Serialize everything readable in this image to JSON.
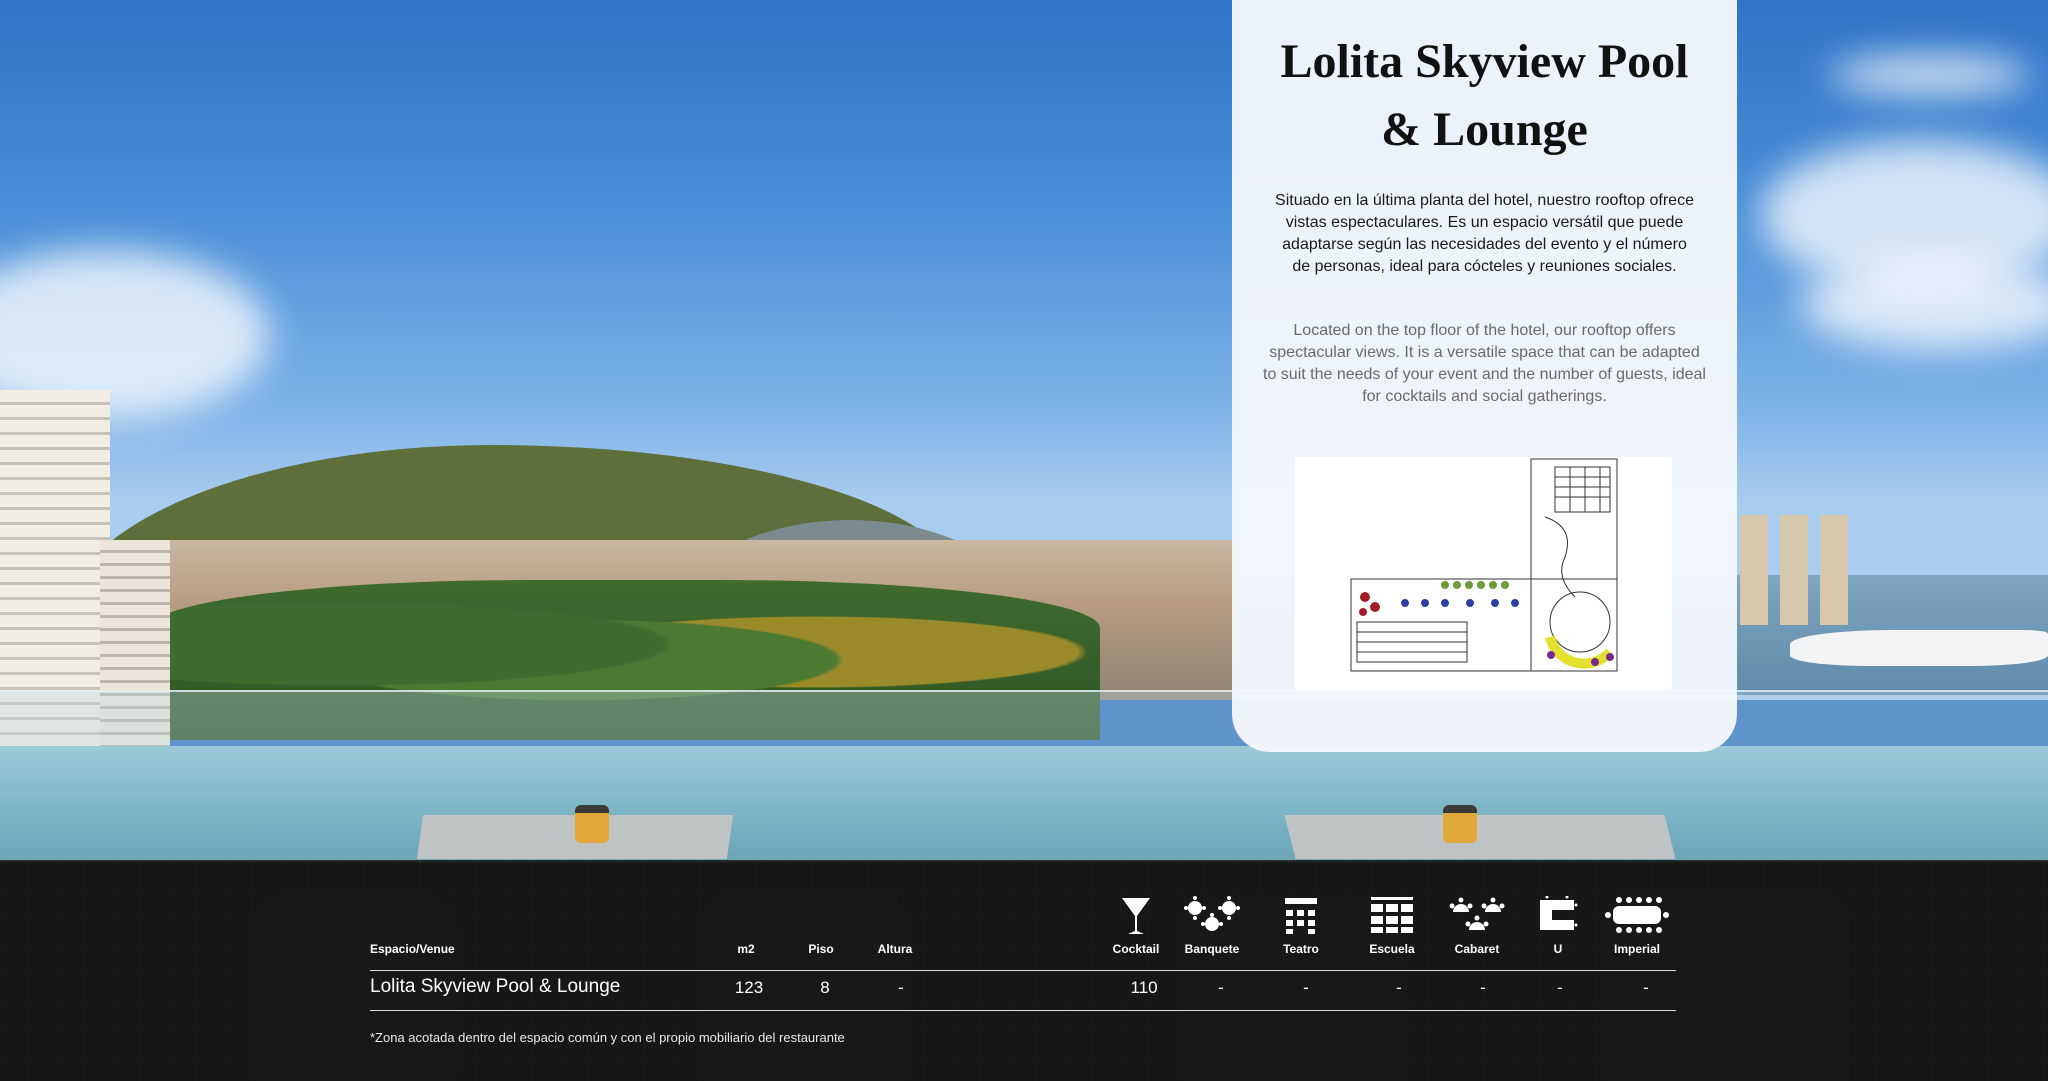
{
  "card": {
    "title": "Lolita Skyview Pool & Lounge",
    "description_es": "Situado en la última planta del hotel, nuestro rooftop ofrece vistas espectaculares. Es un espacio versátil que puede adaptarse según las necesidades del evento y el número de personas, ideal para cócteles y reuniones sociales.",
    "description_en": "Located on the top floor of the hotel, our rooftop offers spectacular views. It is a versatile space that can be adapted to suit the needs of your event and the number of guests, ideal for cocktails and social gatherings."
  },
  "table": {
    "headers": {
      "venue": "Espacio/Venue",
      "m2": "m2",
      "floor": "Piso",
      "height": "Altura",
      "cocktail": "Cocktail",
      "banquet": "Banquete",
      "theatre": "Teatro",
      "classroom": "Escuela",
      "cabaret": "Cabaret",
      "u_shape": "U",
      "imperial": "Imperial"
    },
    "row": {
      "venue": "Lolita Skyview Pool & Lounge",
      "m2": "123",
      "floor": "8",
      "height": "-",
      "cocktail": "110",
      "banquet": "-",
      "theatre": "-",
      "classroom": "-",
      "cabaret": "-",
      "u_shape": "-",
      "imperial": "-"
    },
    "icons": {
      "cocktail": "cocktail-glass-icon",
      "banquet": "banquet-round-tables-icon",
      "theatre": "theatre-rows-icon",
      "classroom": "classroom-desks-icon",
      "cabaret": "cabaret-tables-icon",
      "u_shape": "u-shape-table-icon",
      "imperial": "imperial-table-icon"
    },
    "footnote": "*Zona acotada dentro del espacio común y con el propio mobiliario del restaurante"
  },
  "colors": {
    "card_bg": "#f4f7fc",
    "bar_bg": "#141414",
    "text_light": "#ffffff"
  }
}
